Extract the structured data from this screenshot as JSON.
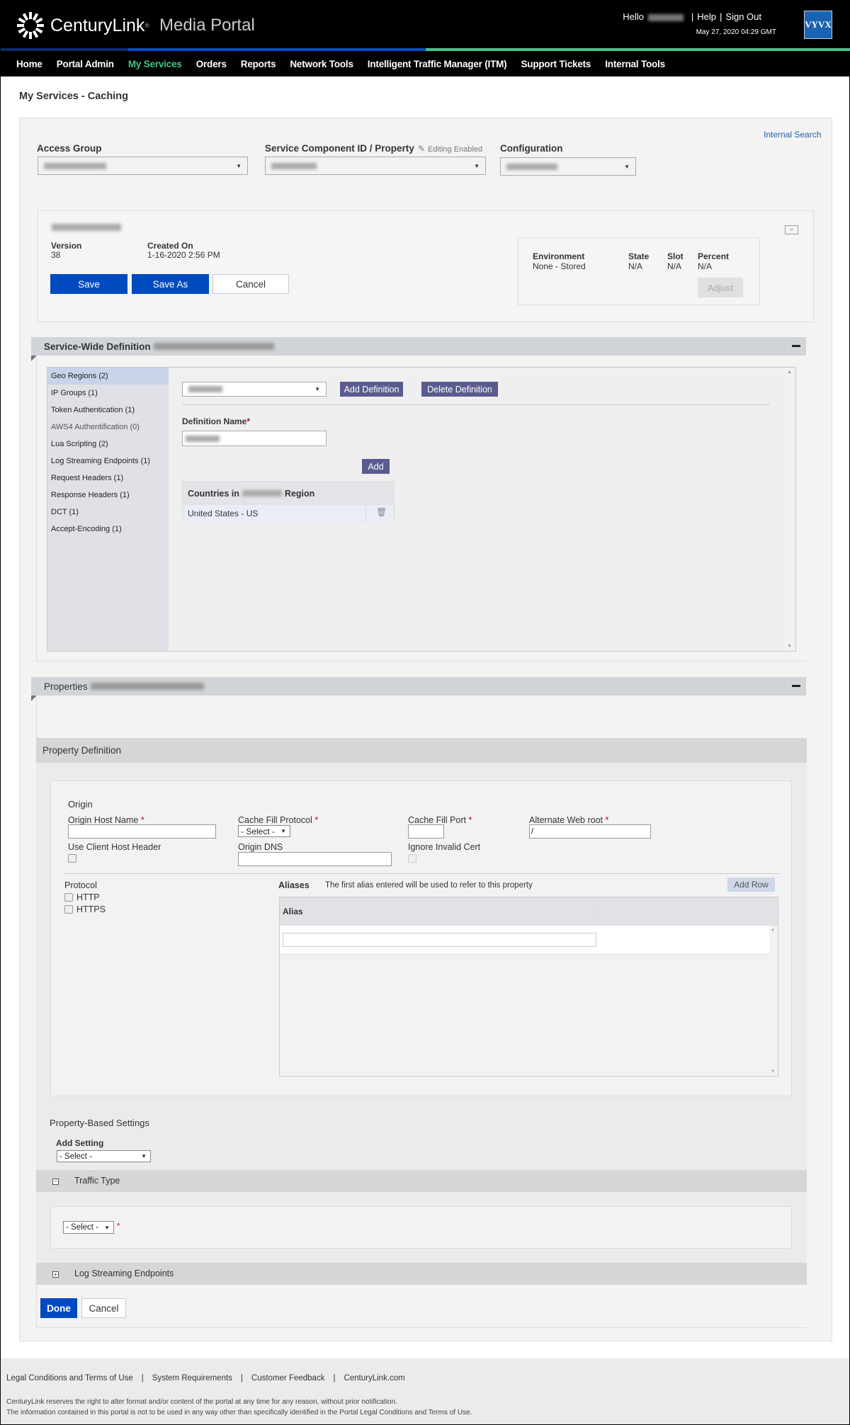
{
  "header": {
    "brand": "CenturyLink",
    "portal": "Media Portal",
    "hello": "Hello",
    "help": "Help",
    "sign_out": "Sign Out",
    "datetime": "May 27, 2020 04:29 GMT",
    "partner_logo": "VYVX",
    "colors": {
      "bar_dark": "#0c2d6b",
      "bar_blue": "#0b4cc0",
      "bar_green": "#45c58a",
      "nav_active": "#45c58a"
    }
  },
  "nav": {
    "items": [
      {
        "label": "Home"
      },
      {
        "label": "Portal Admin"
      },
      {
        "label": "My Services",
        "active": true
      },
      {
        "label": "Orders"
      },
      {
        "label": "Reports"
      },
      {
        "label": "Network Tools"
      },
      {
        "label": "Intelligent Traffic Manager (ITM)"
      },
      {
        "label": "Support Tickets"
      },
      {
        "label": "Internal Tools"
      }
    ]
  },
  "page": {
    "title": "My Services - Caching"
  },
  "selectors": {
    "internal_search": "Internal Search",
    "access_group_label": "Access Group",
    "service_component_label": "Service Component ID / Property",
    "editing_enabled": "Editing Enabled",
    "configuration_label": "Configuration"
  },
  "config": {
    "version_label": "Version",
    "version": "38",
    "created_label": "Created On",
    "created": "1-16-2020 2:56 PM",
    "save": "Save",
    "save_as": "Save As",
    "cancel": "Cancel",
    "env": {
      "headers": [
        "Environment",
        "State",
        "Slot",
        "Percent"
      ],
      "values": [
        "None - Stored",
        "N/A",
        "N/A",
        "N/A"
      ],
      "adjust": "Adjust"
    }
  },
  "service_wide": {
    "title": "Service-Wide Definition",
    "sidebar": [
      {
        "label": "Geo Regions (2)",
        "selected": true
      },
      {
        "label": "IP Groups (1)"
      },
      {
        "label": "Token Authentication (1)"
      },
      {
        "label": "AWS4 Authentification (0)",
        "light": true
      },
      {
        "label": "Lua Scripting (2)"
      },
      {
        "label": "Log Streaming Endpoints (1)"
      },
      {
        "label": "Request Headers (1)"
      },
      {
        "label": "Response Headers (1)"
      },
      {
        "label": "DCT (1)"
      },
      {
        "label": "Accept-Encoding (1)"
      }
    ],
    "add_definition": "Add Definition",
    "delete_definition": "Delete Definition",
    "definition_name_label": "Definition Name",
    "add": "Add",
    "countries_prefix": "Countries in",
    "countries_suffix": "Region",
    "countries": [
      "United States - US"
    ]
  },
  "properties": {
    "title": "Properties",
    "property_definition": "Property Definition",
    "origin": {
      "heading": "Origin",
      "host_name_label": "Origin Host Name",
      "host_name_value": "",
      "cache_fill_protocol_label": "Cache Fill Protocol",
      "cache_fill_protocol_value": "- Select -",
      "cache_fill_port_label": "Cache Fill Port",
      "cache_fill_port_value": "",
      "alt_web_root_label": "Alternate Web root",
      "alt_web_root_value": "/",
      "use_client_host_header_label": "Use Client Host Header",
      "origin_dns_label": "Origin DNS",
      "origin_dns_value": "",
      "ignore_invalid_cert_label": "Ignore Invalid Cert",
      "required_mark": "*"
    },
    "protocol": {
      "label": "Protocol",
      "options": [
        "HTTP",
        "HTTPS"
      ]
    },
    "aliases": {
      "label": "Aliases",
      "hint": "The first alias entered will be used to refer to this property",
      "add_row": "Add Row",
      "column": "Alias",
      "value": ""
    },
    "property_based_settings": {
      "heading": "Property-Based Settings",
      "add_setting_label": "Add Setting",
      "add_setting_value": "- Select -",
      "traffic_type": "Traffic Type",
      "traffic_type_value": "- Select -",
      "log_streaming": "Log Streaming Endpoints"
    },
    "done": "Done",
    "cancel": "Cancel"
  },
  "footer": {
    "links": [
      "Legal Conditions and Terms of Use",
      "System Requirements",
      "Customer Feedback",
      "CenturyLink.com"
    ],
    "note1": "CenturyLink reserves the right to alter format and/or content of the portal at any time for any reason, without prior notification.",
    "note2": "The information contained in this portal is not to be used in any way other than specifically identified in the Portal Legal Conditions and Terms of Use."
  }
}
